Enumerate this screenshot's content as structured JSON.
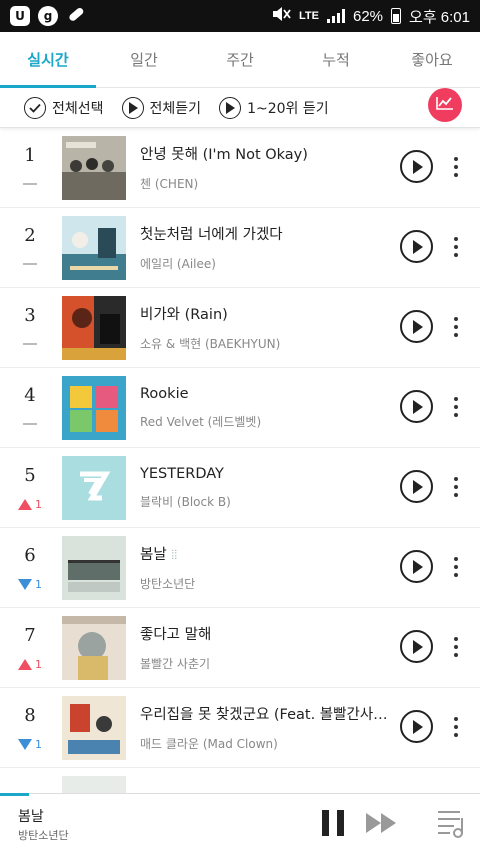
{
  "status_bar": {
    "left_icons": [
      "u-app-icon",
      "g-app-icon",
      "pill-app-icon"
    ],
    "network": "LTE",
    "battery": "62%",
    "time": "오후 6:01"
  },
  "tabs": [
    {
      "label": "실시간",
      "active": true
    },
    {
      "label": "일간",
      "active": false
    },
    {
      "label": "주간",
      "active": false
    },
    {
      "label": "누적",
      "active": false
    },
    {
      "label": "좋아요",
      "active": false
    }
  ],
  "toolbar": {
    "select_all": "전체선택",
    "play_all": "전체듣기",
    "play_top": "1~20위 듣기"
  },
  "songs": [
    {
      "rank": "1",
      "change": "none",
      "change_value": "",
      "title": "안녕 못해 (I'm Not Okay)",
      "artist": "첸 (CHEN)"
    },
    {
      "rank": "2",
      "change": "none",
      "change_value": "",
      "title": "첫눈처럼 너에게 가겠다",
      "artist": "에일리 (Ailee)"
    },
    {
      "rank": "3",
      "change": "none",
      "change_value": "",
      "title": "비가와 (Rain)",
      "artist": "소유 & 백현 (BAEKHYUN)"
    },
    {
      "rank": "4",
      "change": "none",
      "change_value": "",
      "title": "Rookie",
      "artist": "Red Velvet (레드벨벳)"
    },
    {
      "rank": "5",
      "change": "up",
      "change_value": "1",
      "title": "YESTERDAY",
      "artist": "블락비 (Block B)"
    },
    {
      "rank": "6",
      "change": "down",
      "change_value": "1",
      "title": "봄날",
      "artist": "방탄소년단"
    },
    {
      "rank": "7",
      "change": "up",
      "change_value": "1",
      "title": "좋다고 말해",
      "artist": "볼빨간 사춘기"
    },
    {
      "rank": "8",
      "change": "down",
      "change_value": "1",
      "title": "우리집을 못 찾겠군요 (Feat. 볼빨간사…",
      "artist": "매드 클라운 (Mad Clown)"
    }
  ],
  "now_playing": {
    "title": "봄날",
    "artist": "방탄소년단",
    "progress": 0.06
  },
  "colors": {
    "accent": "#1aa7c9",
    "chart_button": "#f03c5f",
    "rank_up": "#ef4f62",
    "rank_down": "#3c8fd6"
  }
}
